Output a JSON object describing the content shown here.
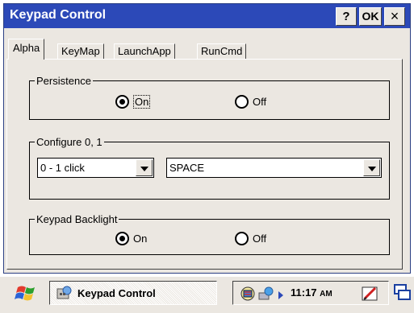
{
  "window": {
    "title": "Keypad Control",
    "help_label": "?",
    "ok_label": "OK",
    "close_label": "×"
  },
  "tabs": [
    {
      "label": "Alpha",
      "active": true
    },
    {
      "label": "KeyMap",
      "active": false
    },
    {
      "label": "LaunchApp",
      "active": false
    },
    {
      "label": "RunCmd",
      "active": false
    }
  ],
  "persistence": {
    "legend": "Persistence",
    "on_label": "On",
    "off_label": "Off",
    "selected": "On"
  },
  "configure": {
    "legend": "Configure 0, 1",
    "click_value": "0 - 1 click",
    "key_value": "SPACE"
  },
  "backlight": {
    "legend": "Keypad Backlight",
    "on_label": "On",
    "off_label": "Off",
    "selected": "On"
  },
  "taskbar": {
    "task_label": "Keypad Control",
    "clock": "11:17",
    "clock_ampm": "AM",
    "icons": [
      "windows-flag-icon",
      "keypad-app-icon",
      "network-icon",
      "connectivity-icon",
      "tray-arrow-icon",
      "input-panel-icon",
      "desktop-icon"
    ]
  },
  "colors": {
    "titlebar": "#2c49b8",
    "dialog_face": "#ebe7e1"
  }
}
